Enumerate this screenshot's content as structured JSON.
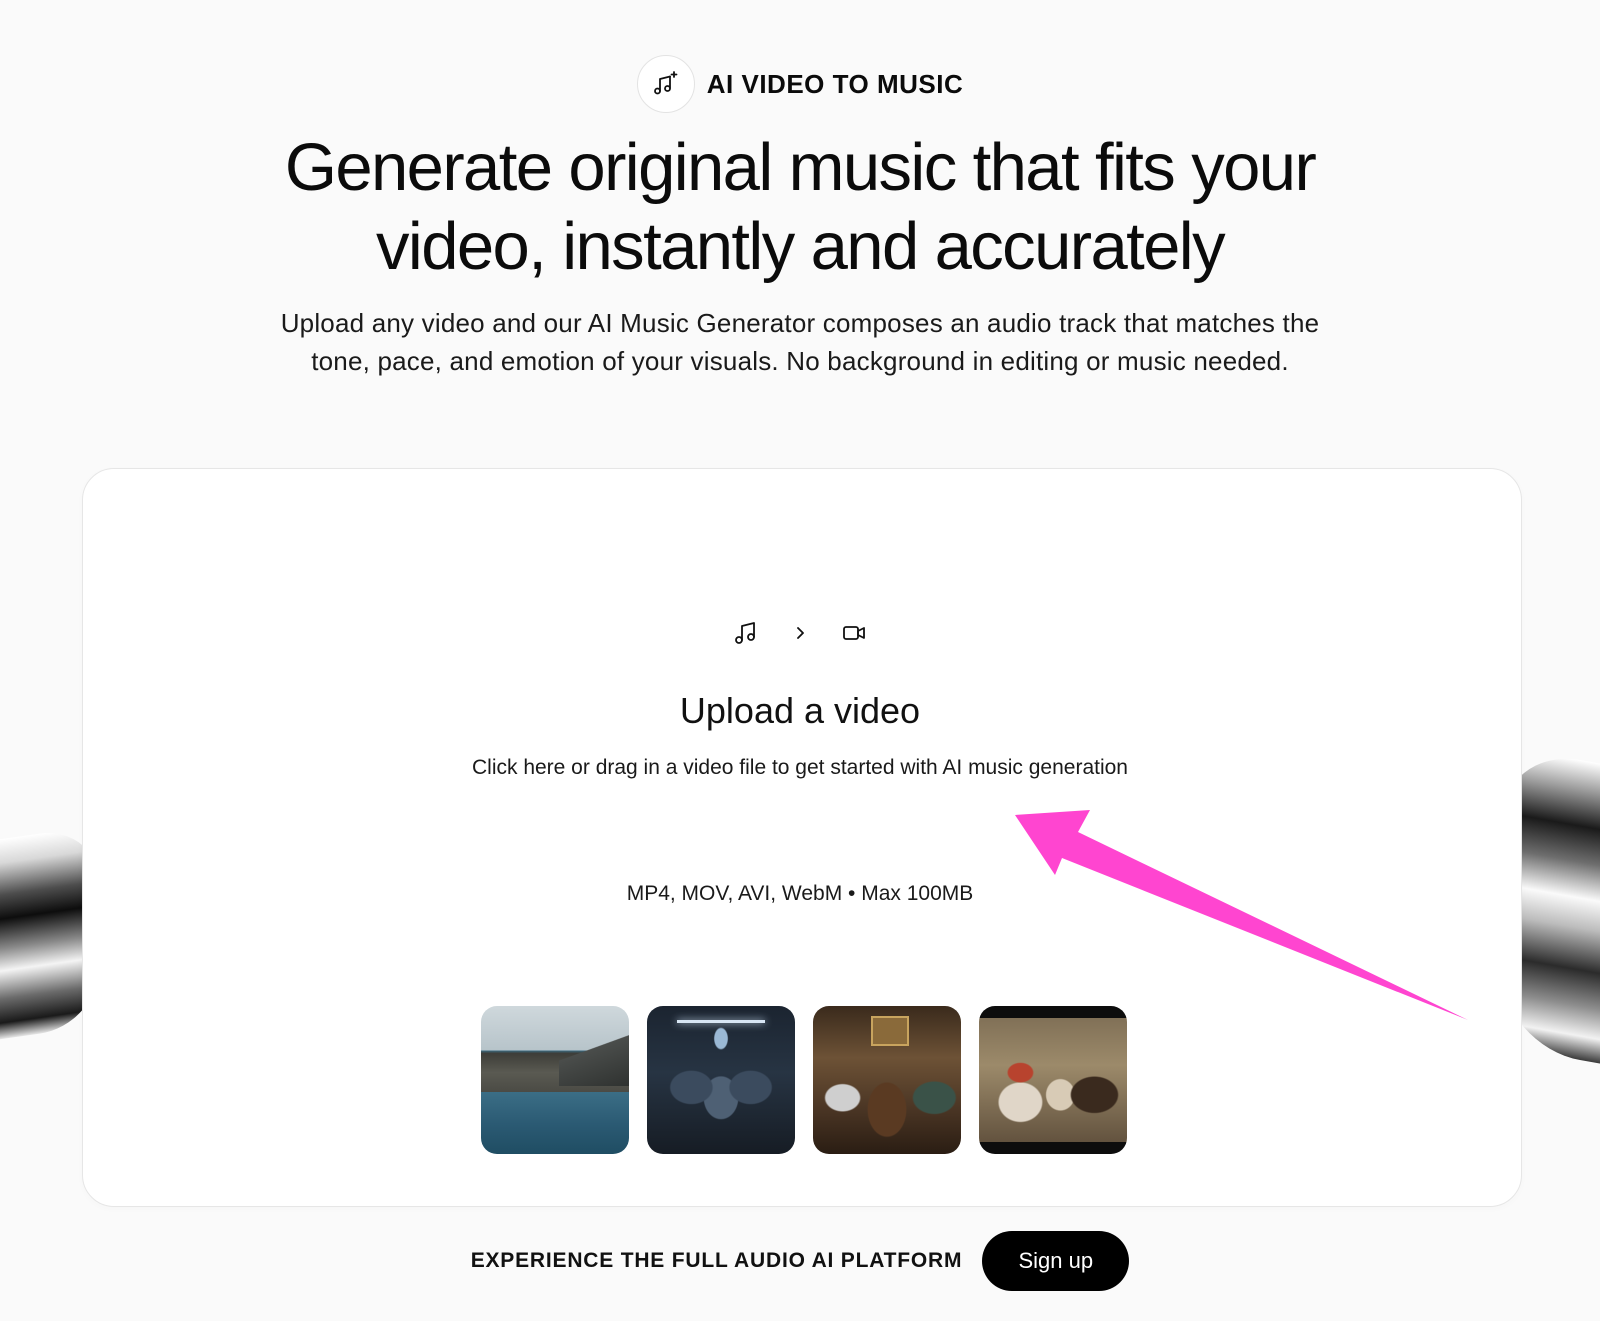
{
  "badge": {
    "icon": "music-notes-sparkle-icon",
    "label": "AI VIDEO TO MUSIC"
  },
  "hero": {
    "headline_line1": "Generate original music that fits your",
    "headline_line2": "video, instantly and accurately",
    "subtitle_line1": "Upload any video and our AI Music Generator composes an audio track that matches the",
    "subtitle_line2": "tone, pace, and emotion of your visuals. No background in editing or music needed."
  },
  "upload": {
    "icons": [
      "music-note-icon",
      "chevron-right-icon",
      "video-camera-icon"
    ],
    "title": "Upload a video",
    "description": "Click here or drag in a video file to get started with AI music generation",
    "formats": "MP4, MOV, AVI, WebM • Max 100MB"
  },
  "samples": [
    {
      "name": "sample-lake"
    },
    {
      "name": "sample-soldiers"
    },
    {
      "name": "sample-parlor"
    },
    {
      "name": "sample-pirates"
    }
  ],
  "annotation": {
    "color": "#ff45d0"
  },
  "footer": {
    "cta_text": "EXPERIENCE THE FULL AUDIO AI PLATFORM",
    "signup_label": "Sign up"
  }
}
